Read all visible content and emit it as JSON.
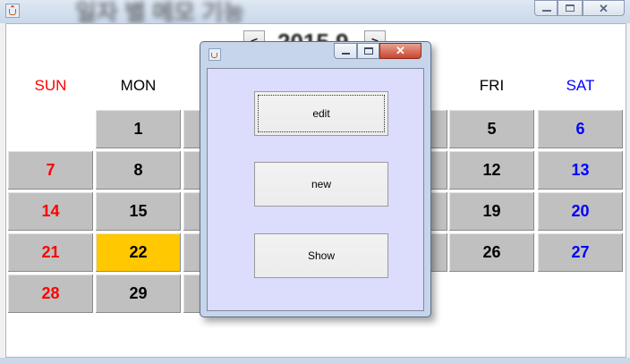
{
  "window": {
    "title": "일자 별 메모 기능",
    "controls": {
      "minimize": "—",
      "maximize": "□",
      "close": "✕"
    }
  },
  "navigation": {
    "prev_label": "<",
    "next_label": ">",
    "month_label": "2015.9"
  },
  "calendar": {
    "weekdays": [
      {
        "label": "SUN",
        "color": "#ff0000"
      },
      {
        "label": "MON",
        "color": "#000000"
      },
      {
        "label": "FRI",
        "color": "#000000"
      },
      {
        "label": "SAT",
        "color": "#0000ff"
      }
    ],
    "visible_cells": {
      "sun": [
        "7",
        "14",
        "21",
        "28"
      ],
      "mon": [
        "1",
        "8",
        "15",
        "22",
        "29"
      ],
      "fri": [
        "5",
        "12",
        "19",
        "26"
      ],
      "sat": [
        "6",
        "13",
        "20",
        "27"
      ]
    },
    "today": "22",
    "colors": {
      "cell": "#c0c0c0",
      "today": "#ffc800",
      "weekend_sun": "#ff0000",
      "weekend_sat": "#0000ff"
    }
  },
  "dialog": {
    "controls": {
      "minimize": "—",
      "maximize": "□",
      "close": "✕"
    },
    "buttons": {
      "edit": "edit",
      "new": "new",
      "show": "Show"
    },
    "background": "#dcdcfc"
  }
}
